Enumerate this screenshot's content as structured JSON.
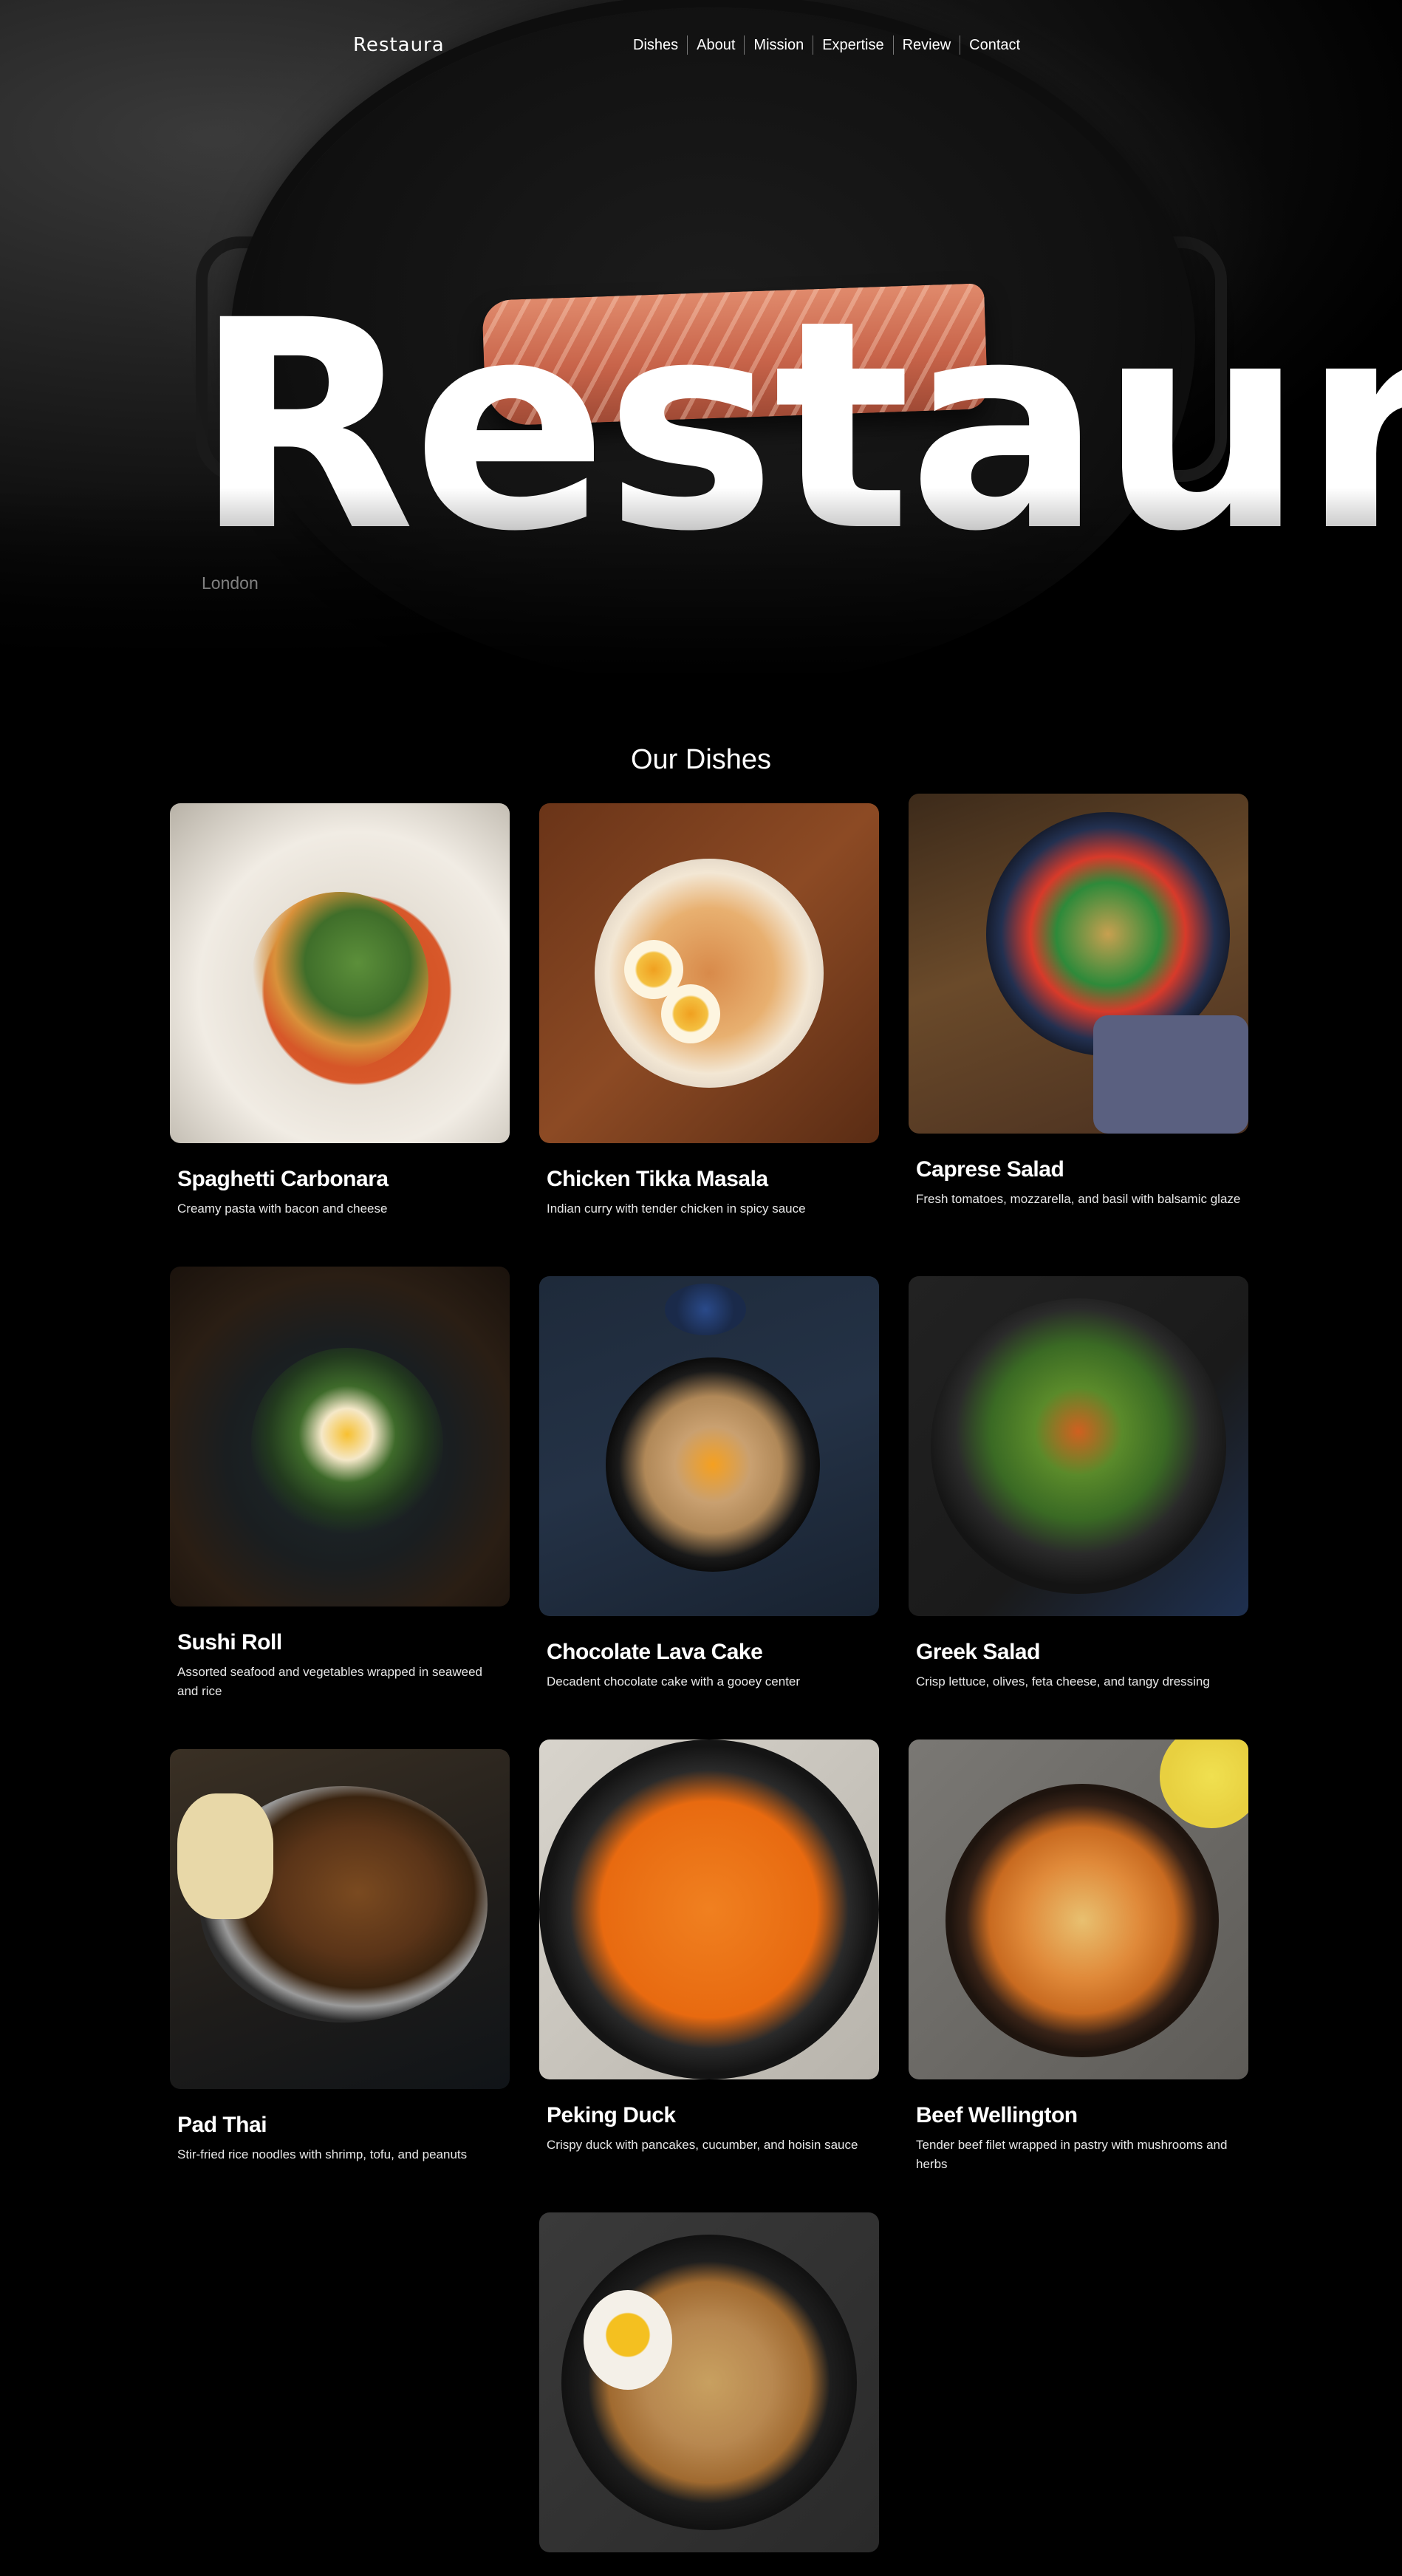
{
  "nav": {
    "logo": "Restaura",
    "links": [
      "Dishes",
      "About",
      "Mission",
      "Expertise",
      "Review",
      "Contact"
    ]
  },
  "hero": {
    "title": "Restaura",
    "subtitle": "London"
  },
  "dishes": {
    "title": "Our Dishes",
    "items": [
      {
        "name": "Spaghetti Carbonara",
        "description": "Creamy pasta with bacon and cheese"
      },
      {
        "name": "Chicken Tikka Masala",
        "description": "Indian curry with tender chicken in spicy sauce"
      },
      {
        "name": "Caprese Salad",
        "description": "Fresh tomatoes, mozzarella, and basil with balsamic glaze"
      },
      {
        "name": "Sushi Roll",
        "description": "Assorted seafood and vegetables wrapped in seaweed and rice"
      },
      {
        "name": "Chocolate Lava Cake",
        "description": "Decadent chocolate cake with a gooey center"
      },
      {
        "name": "Greek Salad",
        "description": "Crisp lettuce, olives, feta cheese, and tangy dressing"
      },
      {
        "name": "Pad Thai",
        "description": "Stir-fried rice noodles with shrimp, tofu, and peanuts"
      },
      {
        "name": "Peking Duck",
        "description": "Crispy duck with pancakes, cucumber, and hoisin sauce"
      },
      {
        "name": "Beef Wellington",
        "description": "Tender beef filet wrapped in pastry with mushrooms and herbs"
      },
      {
        "name": "",
        "description": ""
      }
    ]
  }
}
